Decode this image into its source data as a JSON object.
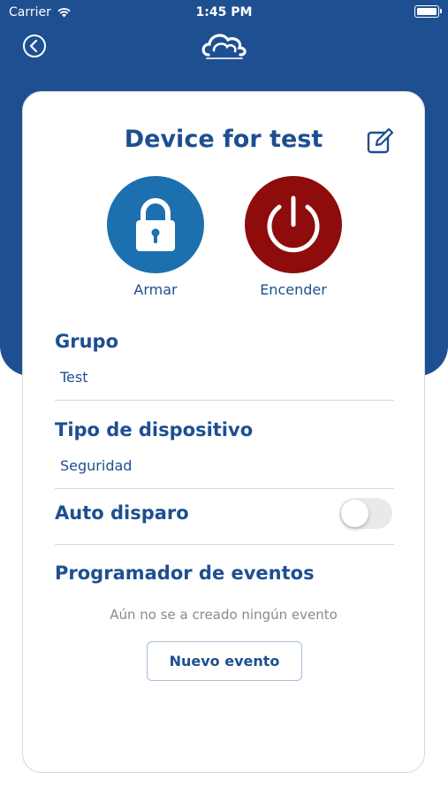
{
  "status_bar": {
    "carrier": "Carrier",
    "time": "1:45 PM"
  },
  "header": {
    "back_icon": "chevron-left-circle-icon",
    "logo_icon": "cloud-logo-icon"
  },
  "device": {
    "title": "Device for test",
    "edit_icon": "edit-icon",
    "actions": {
      "arm": {
        "label": "Armar",
        "icon": "lock-icon",
        "color": "#1c70b0"
      },
      "power": {
        "label": "Encender",
        "icon": "power-icon",
        "color": "#8e0c0c"
      }
    }
  },
  "group": {
    "label": "Grupo",
    "value": "Test"
  },
  "device_type": {
    "label": "Tipo de dispositivo",
    "value": "Seguridad"
  },
  "auto_trigger": {
    "label": "Auto disparo",
    "enabled": false
  },
  "event_scheduler": {
    "label": "Programador de eventos",
    "empty_message": "Aún no se a creado ningún evento",
    "new_event_label": "Nuevo evento"
  },
  "colors": {
    "brand": "#1d4f91",
    "divider": "#d6d6d6",
    "muted_text": "#8a8a8a"
  }
}
